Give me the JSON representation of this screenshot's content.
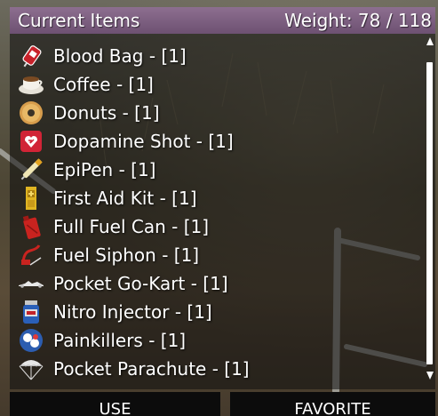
{
  "header": {
    "title": "Current Items",
    "weight": "Weight: 78 / 118"
  },
  "items": [
    {
      "label": "Blood Bag - [1]",
      "icon": "blood-bag-icon"
    },
    {
      "label": "Coffee - [1]",
      "icon": "coffee-icon"
    },
    {
      "label": "Donuts - [1]",
      "icon": "donut-icon"
    },
    {
      "label": "Dopamine Shot - [1]",
      "icon": "dopamine-shot-icon"
    },
    {
      "label": "EpiPen - [1]",
      "icon": "epipen-icon"
    },
    {
      "label": "First Aid Kit - [1]",
      "icon": "first-aid-kit-icon"
    },
    {
      "label": "Full Fuel Can - [1]",
      "icon": "fuel-can-icon"
    },
    {
      "label": "Fuel Siphon - [1]",
      "icon": "fuel-siphon-icon"
    },
    {
      "label": "Pocket Go-Kart - [1]",
      "icon": "go-kart-icon"
    },
    {
      "label": "Nitro Injector - [1]",
      "icon": "nitro-injector-icon"
    },
    {
      "label": "Painkillers - [1]",
      "icon": "painkillers-icon"
    },
    {
      "label": "Pocket Parachute - [1]",
      "icon": "parachute-icon"
    }
  ],
  "buttons": {
    "use": "USE",
    "favorite": "FAVORITE"
  },
  "colors": {
    "header": "#7d6080",
    "panel": "#0c0c0c",
    "text": "#ffffff"
  }
}
